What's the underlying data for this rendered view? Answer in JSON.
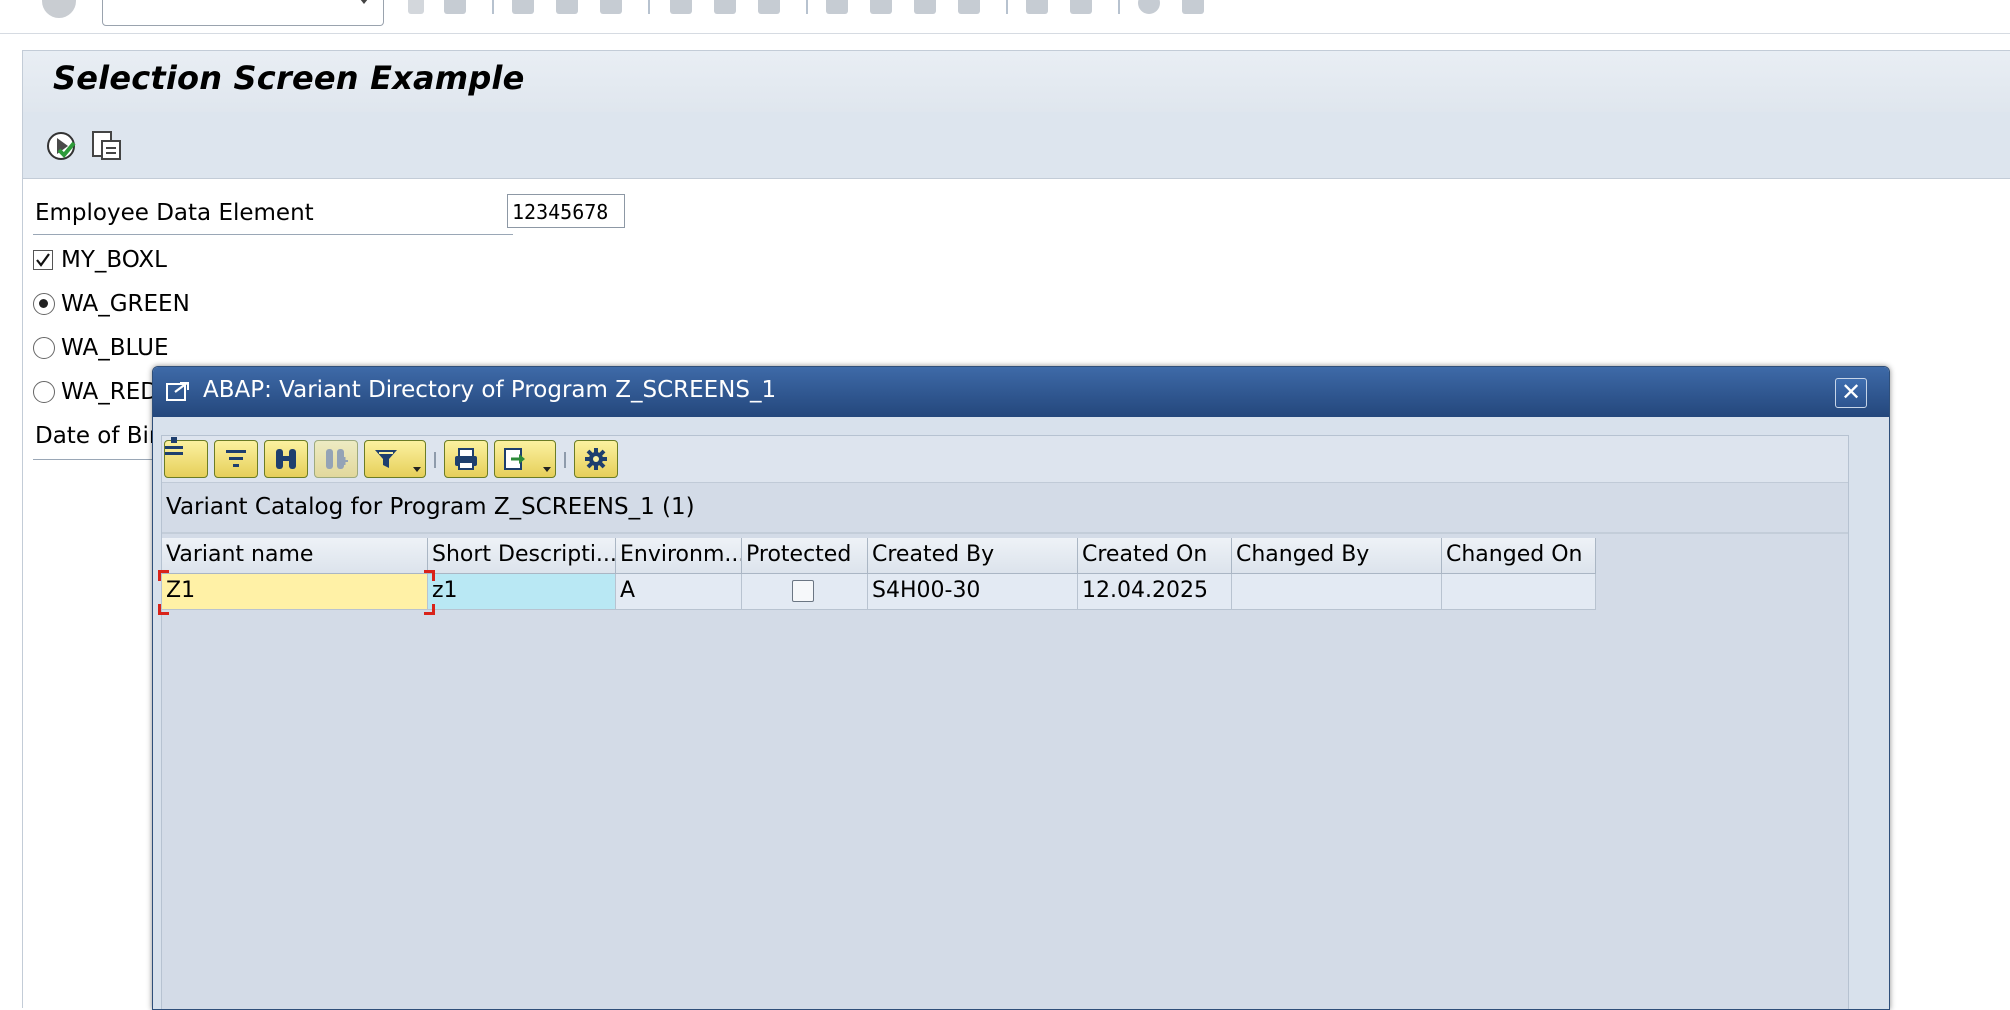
{
  "main": {
    "title": "Selection Screen Example",
    "fields": {
      "employee_label": "Employee Data Element",
      "employee_value": "12345678",
      "checkbox_label": "MY_BOXL",
      "checkbox_checked": true,
      "radio_green_label": "WA_GREEN",
      "radio_blue_label": "WA_BLUE",
      "radio_red_label": "WA_RED",
      "radio_selected": "WA_GREEN",
      "dob_label": "Date of Birth"
    },
    "toolbar_icons": [
      "execute-icon",
      "get-variant-icon"
    ]
  },
  "dialog": {
    "title": "ABAP: Variant Directory of Program Z_SCREENS_1",
    "close_glyph": "✕",
    "catalog_title": "Variant Catalog for Program Z_SCREENS_1 (1)",
    "toolbar_icons": [
      "details-icon",
      "filter-layout-icon",
      "find-icon",
      "find-next-icon",
      "filter-icon",
      "print-icon",
      "export-icon",
      "settings-icon"
    ],
    "table": {
      "columns": [
        "Variant name",
        "Short Descripti...",
        "Environm...",
        "Protected",
        "Created By",
        "Created On",
        "Changed By",
        "Changed On"
      ],
      "rows": [
        {
          "variant_name": "Z1",
          "short_description": "z1",
          "environment": "A",
          "protected": false,
          "created_by": "S4H00-30",
          "created_on": "12.04.2025",
          "changed_by": "",
          "changed_on": ""
        }
      ]
    }
  },
  "colors": {
    "dialog_title_bg": "#2f5896",
    "selected_cell": "#fff1a6",
    "highlight_cell": "#b9e8f4",
    "button_yellow": "#f2e07a"
  }
}
